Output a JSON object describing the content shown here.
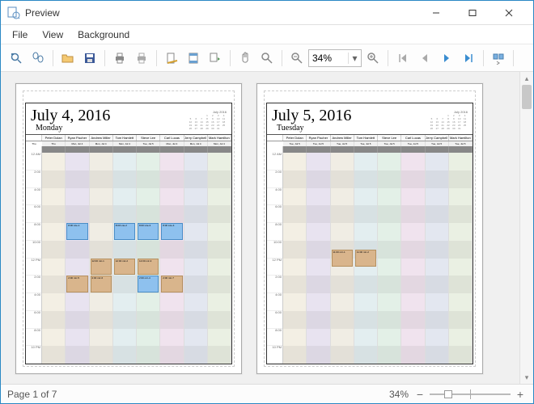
{
  "window": {
    "title": "Preview"
  },
  "menu": {
    "file": "File",
    "view": "View",
    "background": "Background"
  },
  "toolbar": {
    "zoom_value": "34%"
  },
  "status": {
    "page": "Page 1 of 7",
    "zoom": "34%"
  },
  "chart_data": {
    "type": "table",
    "note": "Two-page print preview of a daily scheduler (gantt-style day view)",
    "pages": [
      {
        "date_full": "July 4, 2016",
        "day_name": "Monday",
        "mini_month": "July 2016",
        "resources": [
          "Peter Dolan",
          "Ryan Fischer",
          "Andrew Miller",
          "Tom Hamlett",
          "Steve Lee",
          "Carl Lucas",
          "Jerry Campbell",
          "Mark Hamilton"
        ],
        "sub": [
          "Thu",
          "Mon, Jul 4",
          "Mon, Jul 4",
          "Mon, Jul 4",
          "Tue, Jul 5",
          "Mon, Jul 4",
          "Mon, Jul 4",
          "Mon, Jul 4"
        ],
        "hours": [
          "12 AM",
          "2:00",
          "4:00",
          "6:00",
          "8:00",
          "10:00",
          "12 PM",
          "2:00",
          "4:00",
          "6:00",
          "8:00",
          "10 PM"
        ],
        "appts": [
          {
            "col": 1,
            "start": "8:00",
            "label": "8:00 Lite-1",
            "color": "blue"
          },
          {
            "col": 3,
            "start": "8:00",
            "label": "8:00 Lite-2",
            "color": "blue"
          },
          {
            "col": 4,
            "start": "8:00",
            "label": "8:00 Lite-3",
            "color": "blue"
          },
          {
            "col": 5,
            "start": "8:00",
            "label": "8:00 Lite-4",
            "color": "blue"
          },
          {
            "col": 2,
            "start": "12:00",
            "label": "12:00 mtr-1",
            "color": "brown"
          },
          {
            "col": 3,
            "start": "12:00",
            "label": "12:00 mtr-2",
            "color": "brown"
          },
          {
            "col": 4,
            "start": "12:00",
            "label": "12:00 mtr-3",
            "color": "brown"
          },
          {
            "col": 4,
            "start": "14:00",
            "label": "2:00 mtr-4",
            "color": "blue"
          },
          {
            "col": 1,
            "start": "14:00",
            "label": "2:00 mtr-5",
            "color": "brown"
          },
          {
            "col": 2,
            "start": "14:00",
            "label": "2:00 mtr-6",
            "color": "brown"
          },
          {
            "col": 5,
            "start": "14:00",
            "label": "2:00 mtr-7",
            "color": "brown"
          }
        ]
      },
      {
        "date_full": "July 5, 2016",
        "day_name": "Tuesday",
        "mini_month": "July 2016",
        "resources": [
          "Peter Dolan",
          "Ryan Fischer",
          "Andrew Miller",
          "Tom Hamlett",
          "Steve Lee",
          "Carl Lucas",
          "Jerry Campbell",
          "Mark Hamilton"
        ],
        "sub": [
          "Tue, Jul 5",
          "Tue, Jul 5",
          "Tue, Jul 5",
          "Tue, Jul 5",
          "Tue, Jul 5",
          "Tue, Jul 5",
          "Tue, Jul 5",
          "Tue, Jul 5"
        ],
        "hours": [
          "12 AM",
          "2:00",
          "4:00",
          "6:00",
          "8:00",
          "10:00",
          "12 PM",
          "2:00",
          "4:00",
          "6:00",
          "8:00",
          "10 PM"
        ],
        "appts": [
          {
            "col": 2,
            "start": "11:00",
            "label": "11:00 mtr-1",
            "color": "brown"
          },
          {
            "col": 3,
            "start": "11:00",
            "label": "11:00 mtr-2",
            "color": "brown"
          }
        ]
      }
    ]
  }
}
